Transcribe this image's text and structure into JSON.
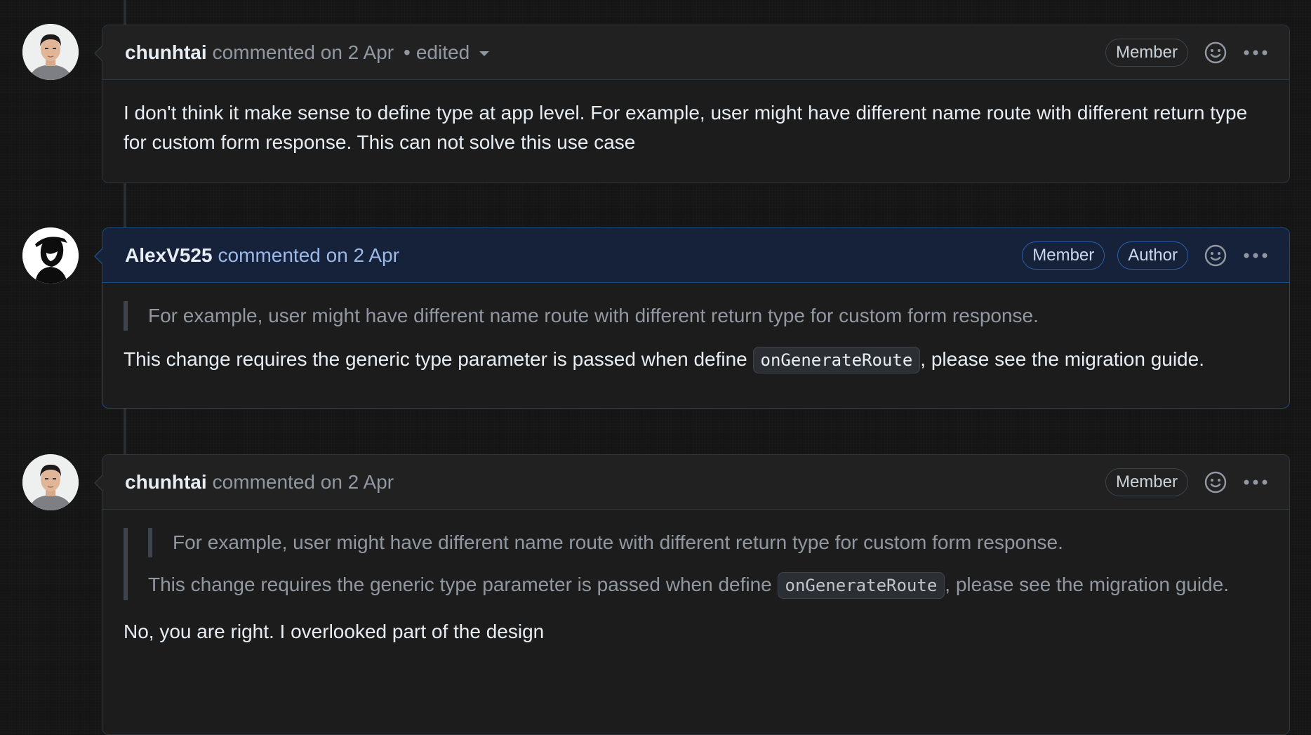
{
  "comments": [
    {
      "username": "chunhtai",
      "meta": "commented on 2 Apr",
      "edited_label": "edited",
      "badges": [
        "Member"
      ],
      "body": "I don't think it make sense to define type at app level. For example, user might have different name route with different return type for custom form response. This can not solve this use case"
    },
    {
      "username": "AlexV525",
      "meta": "commented on 2 Apr",
      "badges": [
        "Member",
        "Author"
      ],
      "quote": "For example, user might have different name route with different return type for custom form response.",
      "body_before_code": "This change requires the generic type parameter is passed when define ",
      "code": "onGenerateRoute",
      "body_after_code": ", please see the migration guide."
    },
    {
      "username": "chunhtai",
      "meta": "commented on 2 Apr",
      "badges": [
        "Member"
      ],
      "inner_quote": "For example, user might have different name route with different return type for custom form response.",
      "quote_before_code": "This change requires the generic type parameter is passed when define ",
      "code": "onGenerateRoute",
      "quote_after_code": ", please see the migration guide.",
      "body": "No, you are right. I overlooked part of the design"
    }
  ],
  "icons": {
    "reaction": "smiley-icon",
    "more": "kebab-horizontal-icon"
  },
  "colors": {
    "background": "#151515",
    "author_border": "#1f4a82",
    "author_header": "#16213a"
  }
}
